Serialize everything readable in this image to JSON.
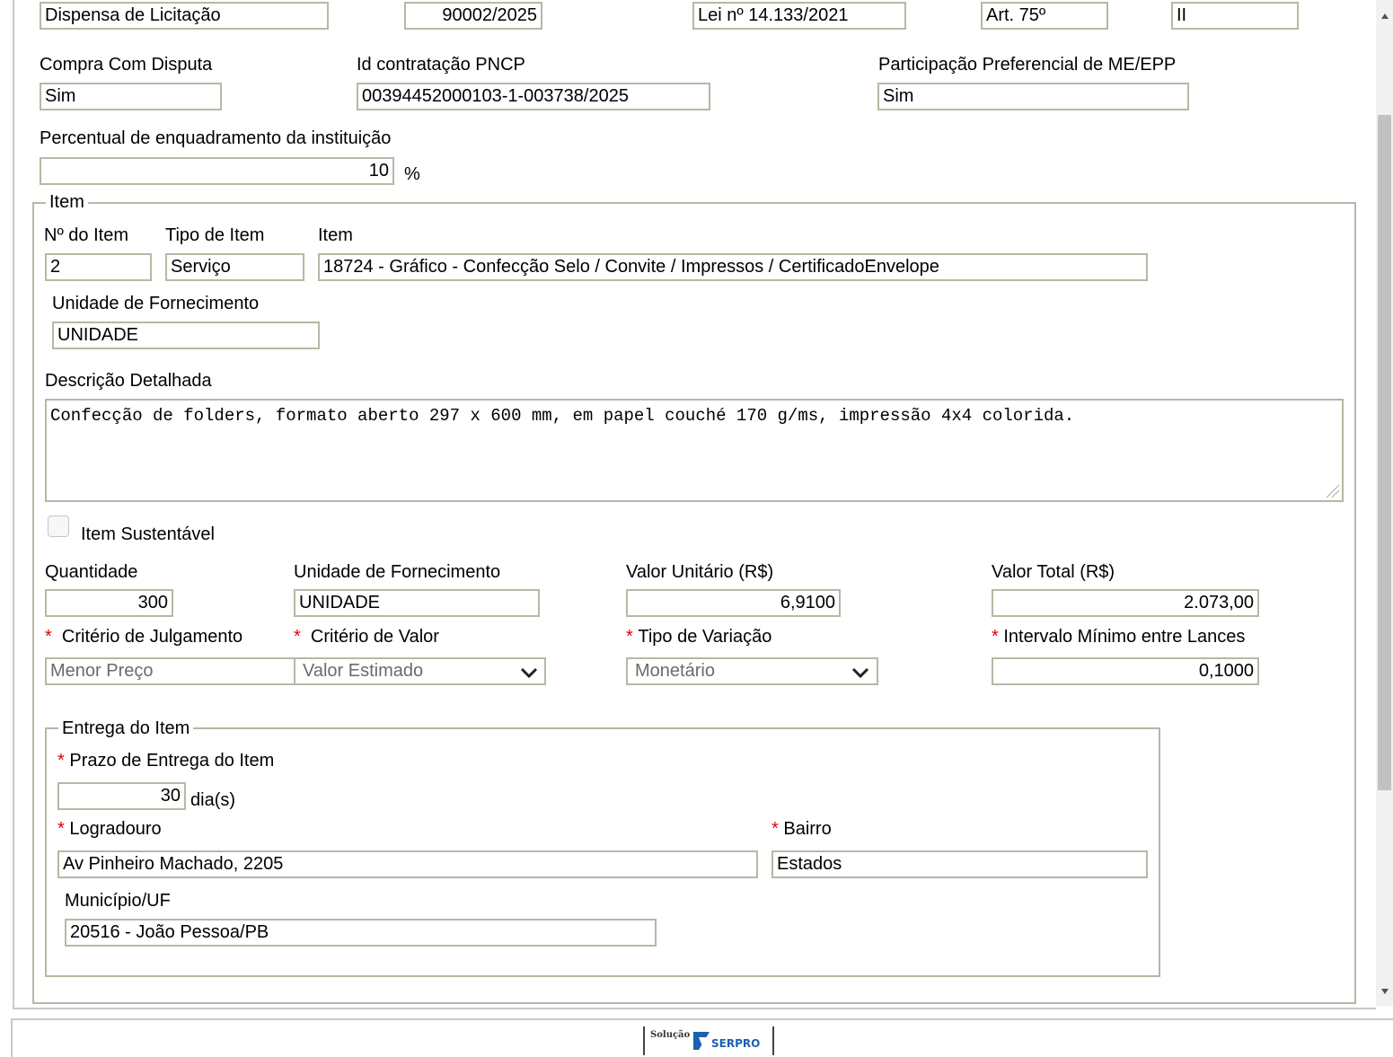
{
  "top_row": {
    "modalidade": "Dispensa de Licitação",
    "numero": "90002/2025",
    "lei": "Lei nº 14.133/2021",
    "artigo": "Art. 75º",
    "inciso": "II"
  },
  "compra_com_disputa": {
    "label": "Compra Com Disputa",
    "value": "Sim"
  },
  "id_contratacao": {
    "label": "Id contratação PNCP",
    "value": "00394452000103-1-003738/2025"
  },
  "participacao": {
    "label": "Participação Preferencial de ME/EPP",
    "value": "Sim"
  },
  "percentual": {
    "label": "Percentual de enquadramento da instituição",
    "value": "10",
    "unit": "%"
  },
  "item_section": {
    "legend": "Item",
    "numero": {
      "label": "Nº do Item",
      "value": "2"
    },
    "tipo": {
      "label": "Tipo de Item",
      "value": "Serviço"
    },
    "item": {
      "label": "Item",
      "value": "18724 - Gráfico - Confecção Selo / Convite / Impressos / CertificadoEnvelope"
    },
    "unidade": {
      "label": "Unidade de Fornecimento",
      "value": "UNIDADE"
    },
    "descricao": {
      "label": "Descrição Detalhada",
      "value": "Confecção de folders, formato aberto 297 x 600 mm, em papel couché 170 g/ms, impressão 4x4 colorida."
    },
    "sustentavel": {
      "label": "Item Sustentável",
      "checked": false
    },
    "quantidade": {
      "label": "Quantidade",
      "value": "300"
    },
    "unidade2": {
      "label": "Unidade de Fornecimento",
      "value": "UNIDADE"
    },
    "valor_unitario": {
      "label": "Valor Unitário (R$)",
      "value": "6,9100"
    },
    "valor_total": {
      "label": "Valor Total (R$)",
      "value": "2.073,00"
    },
    "criterio_julgamento": {
      "label": "Critério de Julgamento",
      "value": "Menor Preço"
    },
    "criterio_valor": {
      "label": "Critério de Valor",
      "value": "Valor Estimado"
    },
    "tipo_variacao": {
      "label": "Tipo de Variação",
      "value": "Monetário"
    },
    "intervalo": {
      "label": "Intervalo Mínimo entre Lances",
      "value": "0,1000"
    },
    "required_mark": "*"
  },
  "entrega": {
    "legend": "Entrega do Item",
    "prazo": {
      "label": "Prazo de Entrega do Item",
      "value": "30",
      "unit": "dia(s)"
    },
    "logradouro": {
      "label": "Logradouro",
      "value": "Av Pinheiro Machado, 2205"
    },
    "bairro": {
      "label": "Bairro",
      "value": "Estados"
    },
    "municipio": {
      "label": "Município/UF",
      "value": "20516 - João Pessoa/PB"
    }
  },
  "footer": {
    "logo_small": "Solução",
    "logo_brand": "SERPRO"
  },
  "icons": {
    "select_arrow": "chevron-down-icon",
    "scroll_up": "arrow-up-icon",
    "scroll_down": "arrow-down-icon"
  }
}
